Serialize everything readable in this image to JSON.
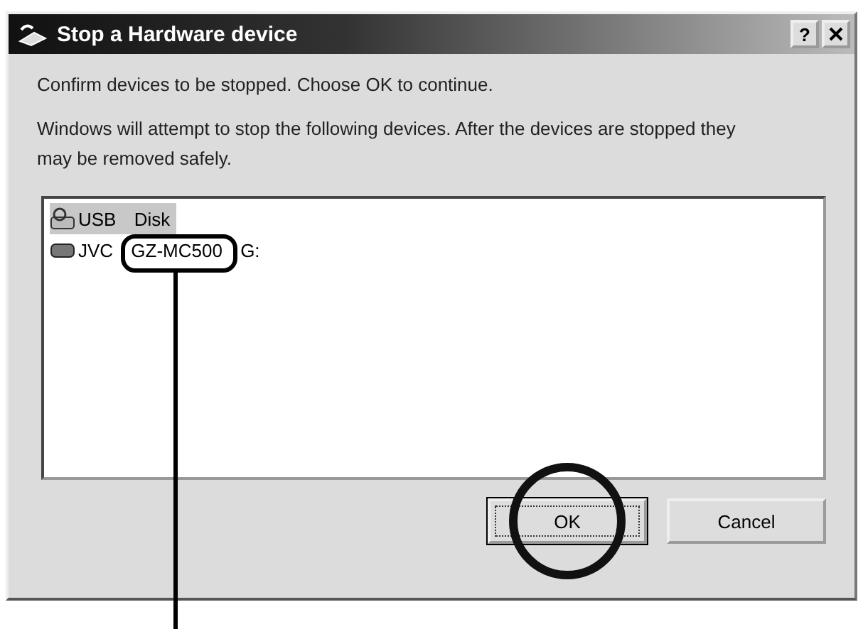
{
  "window": {
    "title": "Stop a Hardware device",
    "help_button": "?"
  },
  "prompt": "Confirm devices to be stopped. Choose OK to continue.",
  "description": "Windows will attempt to stop the following devices. After the devices are stopped they may be removed safely.",
  "devices": [
    {
      "label": "USB Disk",
      "kind": "usb",
      "selected": true
    },
    {
      "label": "JVC GZ-MC500 G:",
      "kind": "drive",
      "selected": false
    }
  ],
  "buttons": [
    {
      "label": "OK",
      "focused": true
    },
    {
      "label": "Cancel",
      "focused": false
    }
  ]
}
